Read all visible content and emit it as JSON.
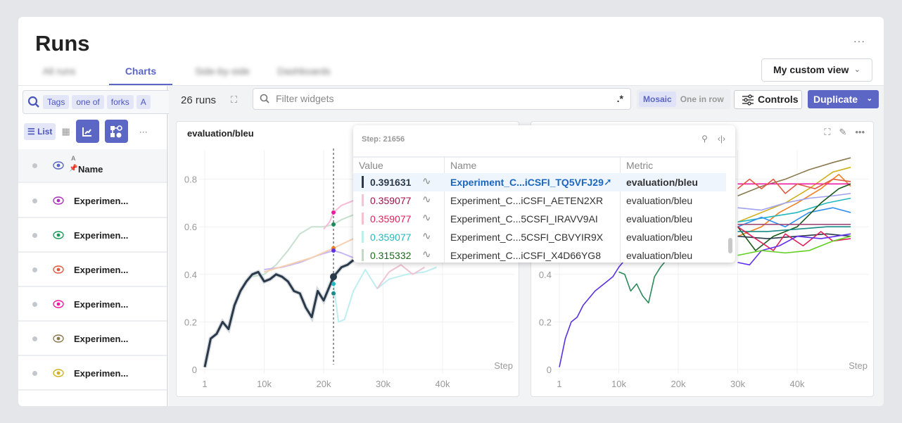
{
  "header": {
    "title": "Runs",
    "more": "···",
    "view_label": "My custom view"
  },
  "tabs": [
    {
      "label": "All runs",
      "active": false
    },
    {
      "label": "Charts",
      "active": true
    },
    {
      "label": "Side-by-side",
      "active": false
    },
    {
      "label": "Dashboards",
      "active": false
    }
  ],
  "sidebar": {
    "filter_chips": [
      "Tags",
      "one of",
      "forks",
      "A"
    ],
    "list_label": "List",
    "more": "···",
    "header": {
      "sort_label": "A",
      "name_label": "Name",
      "eye_color": "#5b66c5"
    },
    "runs": [
      {
        "name": "Experimen...",
        "color": "#b030c0"
      },
      {
        "name": "Experimen...",
        "color": "#1a9a5a"
      },
      {
        "name": "Experimen...",
        "color": "#e05a40"
      },
      {
        "name": "Experimen...",
        "color": "#f01aa0"
      },
      {
        "name": "Experimen...",
        "color": "#8a7a50"
      },
      {
        "name": "Experimen...",
        "color": "#d0b020"
      }
    ]
  },
  "toolbar": {
    "runs_count": "26 runs",
    "filter_placeholder": "Filter widgets",
    "regex_label": ".*",
    "layout_options": [
      "Mosaic",
      "One in row"
    ],
    "layout_selected": "Mosaic",
    "controls_label": "Controls",
    "duplicate_label": "Duplicate",
    "accent": "#5b66c5"
  },
  "tooltip": {
    "step_label": "Step: 21656",
    "columns": [
      "Value",
      "Name",
      "Metric"
    ],
    "rows": [
      {
        "value": "0.391631",
        "name": "Experiment_C...​iCSFI_TQ5VFJ29",
        "metric": "evaluation/bleu",
        "bar": "#2b3a4a",
        "color": "#2b3a4a",
        "selected": true
      },
      {
        "value": "0.359077",
        "name": "Experiment_C...​iCSFI_AETEN2XR",
        "metric": "evaluation/bleu",
        "bar": "#ecc8d6",
        "color": "#a0104a",
        "selected": false
      },
      {
        "value": "0.359077",
        "name": "Experiment_C...​5CSFI_IRAVV9AI",
        "metric": "evaluation/bleu",
        "bar": "#f5c0d0",
        "color": "#e0205a",
        "selected": false
      },
      {
        "value": "0.359077",
        "name": "Experiment_C...​5CSFI_CBVYIR9X",
        "metric": "evaluation/bleu",
        "bar": "#bdeef0",
        "color": "#20b8c0",
        "selected": false
      },
      {
        "value": "0.315332",
        "name": "Experiment_C...​iCSFI_X4D66YG8",
        "metric": "evaluation/bleu",
        "bar": "#c4d8c4",
        "color": "#1a6b1a",
        "selected": false
      }
    ]
  },
  "chart_data": [
    {
      "type": "line",
      "title": "evaluation/bleu",
      "xlabel": "Step",
      "xticks": [
        "1",
        "10k",
        "20k",
        "30k",
        "40k"
      ],
      "yticks": [
        "0",
        "0.2",
        "0.4",
        "0.6",
        "0.8"
      ],
      "xlim": [
        1,
        49000
      ],
      "ylim": [
        0,
        0.9
      ],
      "grid": true,
      "hover_step": 21656,
      "series": [
        {
          "color": "#c8e0d0",
          "faded": true,
          "x": [
            8000,
            10000,
            12000,
            14000,
            16000,
            18000,
            20000,
            21656,
            23000,
            25000
          ],
          "y": [
            0.39,
            0.4,
            0.44,
            0.5,
            0.57,
            0.6,
            0.6,
            0.61,
            0.63,
            0.65
          ]
        },
        {
          "color": "#f8bcd8",
          "faded": true,
          "x": [
            20000,
            21000,
            21656,
            23000,
            25000
          ],
          "y": [
            0.59,
            0.62,
            0.66,
            0.69,
            0.71
          ]
        },
        {
          "color": "#c6b8f4",
          "faded": true,
          "x": [
            10000,
            13000,
            16000,
            19000,
            21656,
            23000,
            25000
          ],
          "y": [
            0.42,
            0.43,
            0.45,
            0.48,
            0.5,
            0.49,
            0.47
          ]
        },
        {
          "color": "#f8d0b0",
          "faded": true,
          "x": [
            10000,
            14000,
            18000,
            21656,
            25000
          ],
          "y": [
            0.41,
            0.44,
            0.47,
            0.51,
            0.55
          ]
        },
        {
          "color": "#bfeef0",
          "faded": true,
          "x": [
            21656,
            22500,
            23500,
            25000,
            27000,
            29000,
            31000,
            34000,
            37000,
            39000
          ],
          "y": [
            0.36,
            0.2,
            0.21,
            0.33,
            0.42,
            0.34,
            0.38,
            0.4,
            0.41,
            0.43
          ]
        },
        {
          "color": "#f0c4d2",
          "faded": true,
          "x": [
            29000,
            31000,
            33000,
            35000,
            37000
          ],
          "y": [
            0.34,
            0.41,
            0.44,
            0.4,
            0.43
          ]
        },
        {
          "color": "#2b3a4a",
          "faded": false,
          "x": [
            1,
            1000,
            2000,
            3000,
            4000,
            5000,
            6000,
            7000,
            8000,
            9000,
            10000,
            11000,
            12000,
            13000,
            14000,
            15000,
            16000,
            17000,
            18000,
            19000,
            20000,
            21000,
            21656,
            23000,
            24000,
            25000
          ],
          "y": [
            0.01,
            0.13,
            0.15,
            0.2,
            0.17,
            0.27,
            0.33,
            0.37,
            0.4,
            0.41,
            0.37,
            0.38,
            0.4,
            0.39,
            0.37,
            0.33,
            0.32,
            0.26,
            0.22,
            0.33,
            0.29,
            0.35,
            0.39,
            0.43,
            0.44,
            0.46
          ]
        }
      ],
      "hover_points": [
        {
          "y": 0.66,
          "color": "#f01aa0"
        },
        {
          "y": 0.61,
          "color": "#1a8a5a"
        },
        {
          "y": 0.51,
          "color": "#f08020"
        },
        {
          "y": 0.5,
          "color": "#6030e0"
        },
        {
          "y": 0.39,
          "color": "#2b3a4a"
        },
        {
          "y": 0.36,
          "color": "#20b8c0"
        },
        {
          "y": 0.32,
          "color": "#1a8a8a"
        }
      ]
    },
    {
      "type": "line",
      "title": "",
      "xlabel": "Step",
      "xticks": [
        "1",
        "10k",
        "20k",
        "30k",
        "40k"
      ],
      "yticks": [
        "0",
        "0.2",
        "0.4",
        "0.6",
        "0.8"
      ],
      "xlim": [
        1,
        49000
      ],
      "ylim": [
        0,
        0.9
      ],
      "grid": true,
      "series": [
        {
          "color": "#5a30e0",
          "x": [
            1,
            1000,
            2000,
            3000,
            4000,
            5000,
            6000,
            7000,
            8000,
            9000,
            10000,
            11000
          ],
          "y": [
            0.01,
            0.13,
            0.2,
            0.22,
            0.27,
            0.3,
            0.33,
            0.35,
            0.37,
            0.39,
            0.43,
            0.46
          ]
        },
        {
          "color": "#2a8a5a",
          "x": [
            10000,
            11000,
            12000,
            13000,
            14000,
            15000,
            16000,
            17000,
            18000
          ],
          "y": [
            0.41,
            0.4,
            0.33,
            0.36,
            0.31,
            0.28,
            0.39,
            0.43,
            0.46
          ]
        },
        {
          "color": "#8a7a50",
          "x": [
            30000,
            34000,
            38000,
            42000,
            46000,
            49000
          ],
          "y": [
            0.73,
            0.77,
            0.8,
            0.84,
            0.87,
            0.89
          ]
        },
        {
          "color": "#d0b020",
          "x": [
            30000,
            34000,
            38000,
            42000,
            46000,
            49000
          ],
          "y": [
            0.62,
            0.66,
            0.7,
            0.76,
            0.83,
            0.85
          ]
        },
        {
          "color": "#f08020",
          "x": [
            30000,
            34000,
            37000,
            40000,
            44000,
            47000,
            49000
          ],
          "y": [
            0.56,
            0.6,
            0.66,
            0.7,
            0.76,
            0.82,
            0.77
          ]
        },
        {
          "color": "#f01aa0",
          "x": [
            30000,
            49000
          ],
          "y": [
            0.78,
            0.78
          ]
        },
        {
          "color": "#e05a40",
          "x": [
            30000,
            32000,
            34000,
            36000,
            38000,
            40000,
            43000,
            46000,
            49000
          ],
          "y": [
            0.76,
            0.8,
            0.76,
            0.8,
            0.74,
            0.78,
            0.76,
            0.8,
            0.79
          ]
        },
        {
          "color": "#a0a0f0",
          "x": [
            30000,
            34000,
            38000,
            42000,
            46000,
            49000
          ],
          "y": [
            0.68,
            0.67,
            0.7,
            0.72,
            0.73,
            0.74
          ]
        },
        {
          "color": "#20b8c0",
          "x": [
            30000,
            35000,
            40000,
            45000,
            49000
          ],
          "y": [
            0.62,
            0.64,
            0.66,
            0.7,
            0.72
          ]
        },
        {
          "color": "#3090f0",
          "x": [
            30000,
            34000,
            38000,
            42000,
            46000,
            49000
          ],
          "y": [
            0.6,
            0.64,
            0.6,
            0.66,
            0.68,
            0.66
          ]
        },
        {
          "color": "#1a5a1a",
          "x": [
            30000,
            33000,
            36000,
            40000,
            44000,
            47000,
            49000
          ],
          "y": [
            0.6,
            0.5,
            0.56,
            0.6,
            0.7,
            0.76,
            0.78
          ]
        },
        {
          "color": "#a04a7a",
          "x": [
            30000,
            49000
          ],
          "y": [
            0.61,
            0.61
          ]
        },
        {
          "color": "#2b3a4a",
          "x": [
            30000,
            35000,
            40000,
            45000,
            49000
          ],
          "y": [
            0.56,
            0.55,
            0.56,
            0.57,
            0.56
          ]
        },
        {
          "color": "#1a8a8a",
          "x": [
            30000,
            35000,
            40000,
            45000,
            49000
          ],
          "y": [
            0.58,
            0.58,
            0.59,
            0.6,
            0.6
          ]
        },
        {
          "color": "#e0205a",
          "x": [
            30000,
            33000,
            36000,
            38000,
            41000,
            44000,
            46000,
            49000
          ],
          "y": [
            0.6,
            0.55,
            0.5,
            0.57,
            0.52,
            0.58,
            0.54,
            0.55
          ]
        },
        {
          "color": "#6030f0",
          "x": [
            30000,
            32000,
            34000,
            37000,
            40000,
            44000,
            49000
          ],
          "y": [
            0.45,
            0.44,
            0.5,
            0.52,
            0.56,
            0.55,
            0.57
          ]
        },
        {
          "color": "#60d020",
          "x": [
            30000,
            34000,
            38000,
            42000,
            46000,
            49000
          ],
          "y": [
            0.48,
            0.5,
            0.49,
            0.5,
            0.54,
            0.56
          ]
        }
      ]
    }
  ]
}
